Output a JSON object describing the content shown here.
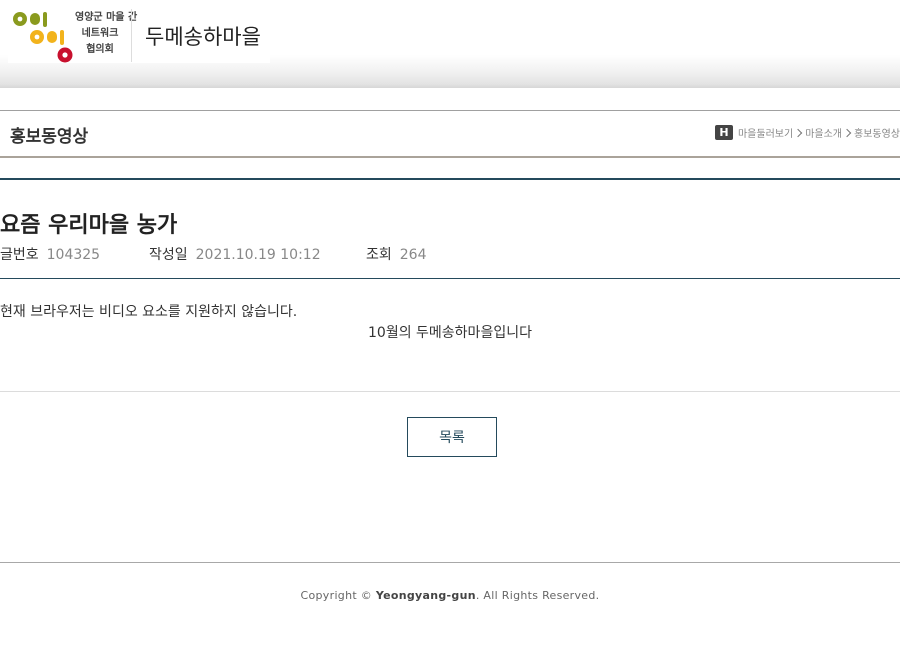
{
  "header": {
    "logo_lines": [
      "영양군 마을 간",
      "네트워크",
      "협의회"
    ],
    "site_title": "두메송하마을"
  },
  "page": {
    "title": "홍보동영상",
    "breadcrumb": {
      "home_icon_label": "H",
      "items": [
        "마을둘러보기",
        "마을소개",
        "홍보동영상"
      ]
    }
  },
  "post": {
    "title": "요즘 우리마을 농가",
    "meta": [
      {
        "label": "글번호",
        "value": "104325"
      },
      {
        "label": "작성일",
        "value": "2021.10.19 10:12"
      },
      {
        "label": "조회",
        "value": "264"
      }
    ],
    "video_fallback": "현재 브라우저는 비디오 요소를 지원하지 않습니다.",
    "caption": "10월의 두메송하마을입니다"
  },
  "actions": {
    "list_label": "목록"
  },
  "footer": {
    "copyright_prefix": "Copyright © ",
    "copyright_brand": "Yeongyang-gun",
    "copyright_suffix": ". All Rights Reserved."
  },
  "colors": {
    "accent": "#244a5c",
    "logo_olive": "#8a9a1e",
    "logo_yellow": "#f2b31c",
    "logo_red": "#c8102e"
  }
}
